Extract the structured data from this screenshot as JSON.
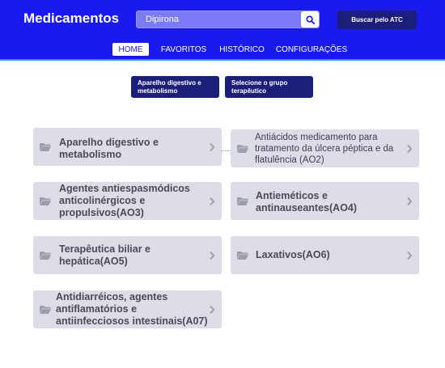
{
  "header": {
    "title": "Medicamentos",
    "search": {
      "value": "Dipirona",
      "placeholder": ""
    },
    "search_button_icon": "search-icon",
    "atc_button_label": "Buscar pelo ATC",
    "background_color": "#1a1aee"
  },
  "nav": {
    "items": [
      {
        "label": "HOME",
        "active": true
      },
      {
        "label": "FAVORITOS",
        "active": false
      },
      {
        "label": "HISTÓRICO",
        "active": false
      },
      {
        "label": "CONFIGURAÇÕES",
        "active": false
      }
    ]
  },
  "filters": {
    "group": "Aparelho digestivo e metabolismo",
    "subgroup": "Selecione o grupo terapêutico"
  },
  "cards": [
    {
      "label": "Aparelho digestivo e metabolismo",
      "icon": "folder-icon"
    },
    {
      "label": "Antiácidos medicamento para tratamento da úlcera péptica e da flatulência (AO2)",
      "icon": "folder-icon"
    },
    {
      "label": "Agentes antiespasmódicos anticolinérgicos e propulsivos(AO3)",
      "icon": "folder-icon"
    },
    {
      "label": "Antieméticos e antinauseantes(AO4)",
      "icon": "folder-icon"
    },
    {
      "label": "Terapêutica biliar e hepática(AO5)",
      "icon": "folder-icon"
    },
    {
      "label": "Laxativos(AO6)",
      "icon": "folder-icon"
    },
    {
      "label": "Antidiarréicos, agentes antiflamatórios e antiinfecciosos intestinais(A07)",
      "icon": "folder-icon"
    }
  ]
}
